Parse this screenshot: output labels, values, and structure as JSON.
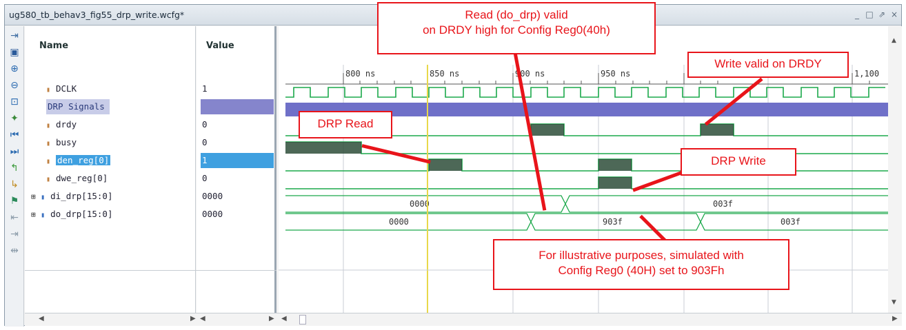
{
  "window": {
    "title": "ug580_tb_behav3_fig55_drp_write.wcfg*",
    "controls": [
      "_",
      "□",
      "⇗",
      "×"
    ]
  },
  "columns": {
    "name_header": "Name",
    "value_header": "Value"
  },
  "signals": [
    {
      "name": "DCLK",
      "value": "1",
      "type": "bit"
    },
    {
      "name": "DRP Signals",
      "value": "",
      "type": "group"
    },
    {
      "name": "drdy",
      "value": "0",
      "type": "bit"
    },
    {
      "name": "busy",
      "value": "0",
      "type": "bit"
    },
    {
      "name": "den_reg[0]",
      "value": "1",
      "type": "bit",
      "selected": true
    },
    {
      "name": "dwe_reg[0]",
      "value": "0",
      "type": "bit"
    },
    {
      "name": "di_drp[15:0]",
      "value": "0000",
      "type": "bus"
    },
    {
      "name": "do_drp[15:0]",
      "value": "0000",
      "type": "bus"
    }
  ],
  "timeline": {
    "ticks": [
      "800 ns",
      "850 ns",
      "900 ns",
      "950 ns",
      "1,100"
    ],
    "cursor_time_ns": 850
  },
  "bus_values": {
    "di_drp": [
      "0000",
      "003f"
    ],
    "do_drp": [
      "0000",
      "903f",
      "003f"
    ]
  },
  "callouts": {
    "read_valid": "Read (do_drp) valid\non DRDY high for Config Reg0(40h)",
    "write_valid": "Write valid on DRDY",
    "drp_read": "DRP Read",
    "drp_write": "DRP Write",
    "illustrative": "For illustrative purposes, simulated with\nConfig Reg0 (40H) set to 903Fh"
  },
  "colors": {
    "wave_green": "#1aa84a",
    "wave_fill": "#2e4e3a",
    "group_band": "#6f70c8",
    "selected_row": "#3fa0e0",
    "cursor": "#e8d84a",
    "callout_red": "#e8141a"
  }
}
